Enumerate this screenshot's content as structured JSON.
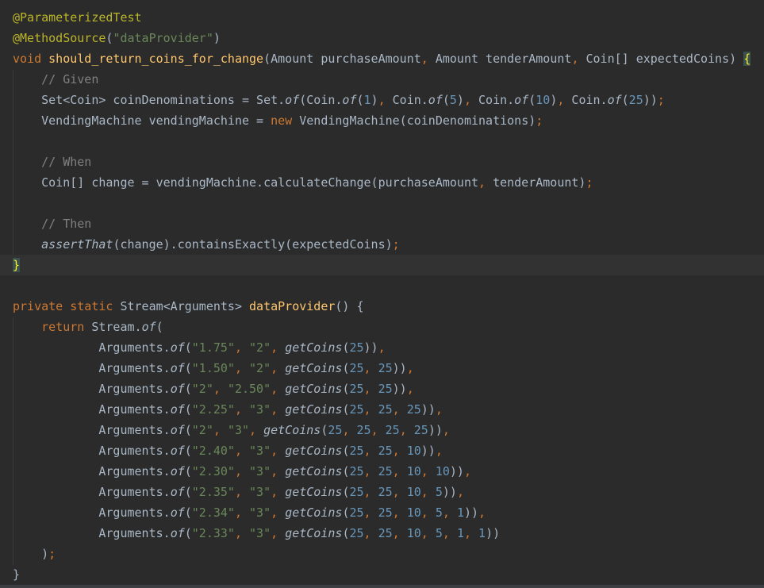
{
  "editor": {
    "colors": {
      "background": "#2b2b2b",
      "text": "#a9b7c6",
      "annotation": "#bbb529",
      "keyword": "#cc7832",
      "string": "#6a8759",
      "number": "#6897bb",
      "method_decl": "#ffc66d",
      "comment": "#808080"
    },
    "lines": [
      {
        "segs": [
          {
            "t": "@ParameterizedTest",
            "c": "ann"
          }
        ]
      },
      {
        "segs": [
          {
            "t": "@MethodSource",
            "c": "ann"
          },
          {
            "t": "("
          },
          {
            "t": "\"dataProvider\"",
            "c": "str"
          },
          {
            "t": ")"
          }
        ]
      },
      {
        "segs": [
          {
            "t": "void ",
            "c": "kw"
          },
          {
            "t": "should_return_coins_for_change",
            "c": "fn"
          },
          {
            "t": "(Amount purchaseAmount"
          },
          {
            "t": ", ",
            "c": "kw"
          },
          {
            "t": "Amount tenderAmount"
          },
          {
            "t": ", ",
            "c": "kw"
          },
          {
            "t": "Coin[] expectedCoins) "
          },
          {
            "t": "{",
            "c": "brace-match"
          }
        ]
      },
      {
        "segs": [
          {
            "t": "    "
          },
          {
            "t": "// Given",
            "c": "cm"
          }
        ]
      },
      {
        "segs": [
          {
            "t": "    Set<Coin> coinDenominations = Set."
          },
          {
            "t": "of",
            "c": "it"
          },
          {
            "t": "(Coin."
          },
          {
            "t": "of",
            "c": "it"
          },
          {
            "t": "("
          },
          {
            "t": "1",
            "c": "num"
          },
          {
            "t": ")"
          },
          {
            "t": ", ",
            "c": "kw"
          },
          {
            "t": "Coin."
          },
          {
            "t": "of",
            "c": "it"
          },
          {
            "t": "("
          },
          {
            "t": "5",
            "c": "num"
          },
          {
            "t": ")"
          },
          {
            "t": ", ",
            "c": "kw"
          },
          {
            "t": "Coin."
          },
          {
            "t": "of",
            "c": "it"
          },
          {
            "t": "("
          },
          {
            "t": "10",
            "c": "num"
          },
          {
            "t": ")"
          },
          {
            "t": ", ",
            "c": "kw"
          },
          {
            "t": "Coin."
          },
          {
            "t": "of",
            "c": "it"
          },
          {
            "t": "("
          },
          {
            "t": "25",
            "c": "num"
          },
          {
            "t": "))"
          },
          {
            "t": ";",
            "c": "kw"
          }
        ]
      },
      {
        "segs": [
          {
            "t": "    VendingMachine vendingMachine = "
          },
          {
            "t": "new ",
            "c": "kw"
          },
          {
            "t": "VendingMachine(coinDenominations)"
          },
          {
            "t": ";",
            "c": "kw"
          }
        ]
      },
      {
        "segs": [
          {
            "t": ""
          }
        ]
      },
      {
        "segs": [
          {
            "t": "    "
          },
          {
            "t": "// When",
            "c": "cm"
          }
        ]
      },
      {
        "segs": [
          {
            "t": "    Coin[] change = vendingMachine.calculateChange(purchaseAmount"
          },
          {
            "t": ", ",
            "c": "kw"
          },
          {
            "t": "tenderAmount)"
          },
          {
            "t": ";",
            "c": "kw"
          }
        ]
      },
      {
        "segs": [
          {
            "t": ""
          }
        ]
      },
      {
        "segs": [
          {
            "t": "    "
          },
          {
            "t": "// Then",
            "c": "cm"
          }
        ]
      },
      {
        "segs": [
          {
            "t": "    "
          },
          {
            "t": "assertThat",
            "c": "it"
          },
          {
            "t": "(change).containsExactly(expectedCoins)"
          },
          {
            "t": ";",
            "c": "kw"
          }
        ]
      },
      {
        "segs": [
          {
            "t": "}",
            "c": "brace-match"
          }
        ]
      },
      {
        "segs": [
          {
            "t": ""
          }
        ]
      },
      {
        "segs": [
          {
            "t": "private static ",
            "c": "kw"
          },
          {
            "t": "Stream<Arguments> "
          },
          {
            "t": "dataProvider",
            "c": "fn"
          },
          {
            "t": "() {"
          }
        ]
      },
      {
        "segs": [
          {
            "t": "    "
          },
          {
            "t": "return ",
            "c": "kw"
          },
          {
            "t": "Stream."
          },
          {
            "t": "of",
            "c": "it"
          },
          {
            "t": "("
          }
        ]
      },
      {
        "segs": [
          {
            "t": "            Arguments."
          },
          {
            "t": "of",
            "c": "it"
          },
          {
            "t": "("
          },
          {
            "t": "\"1.75\"",
            "c": "str"
          },
          {
            "t": ", ",
            "c": "kw"
          },
          {
            "t": "\"2\"",
            "c": "str"
          },
          {
            "t": ", ",
            "c": "kw"
          },
          {
            "t": "getCoins",
            "c": "it"
          },
          {
            "t": "("
          },
          {
            "t": "25",
            "c": "num"
          },
          {
            "t": "))"
          },
          {
            "t": ",",
            "c": "kw"
          }
        ]
      },
      {
        "segs": [
          {
            "t": "            Arguments."
          },
          {
            "t": "of",
            "c": "it"
          },
          {
            "t": "("
          },
          {
            "t": "\"1.50\"",
            "c": "str"
          },
          {
            "t": ", ",
            "c": "kw"
          },
          {
            "t": "\"2\"",
            "c": "str"
          },
          {
            "t": ", ",
            "c": "kw"
          },
          {
            "t": "getCoins",
            "c": "it"
          },
          {
            "t": "("
          },
          {
            "t": "25",
            "c": "num"
          },
          {
            "t": ", ",
            "c": "kw"
          },
          {
            "t": "25",
            "c": "num"
          },
          {
            "t": "))"
          },
          {
            "t": ",",
            "c": "kw"
          }
        ]
      },
      {
        "segs": [
          {
            "t": "            Arguments."
          },
          {
            "t": "of",
            "c": "it"
          },
          {
            "t": "("
          },
          {
            "t": "\"2\"",
            "c": "str"
          },
          {
            "t": ", ",
            "c": "kw"
          },
          {
            "t": "\"2.50\"",
            "c": "str"
          },
          {
            "t": ", ",
            "c": "kw"
          },
          {
            "t": "getCoins",
            "c": "it"
          },
          {
            "t": "("
          },
          {
            "t": "25",
            "c": "num"
          },
          {
            "t": ", ",
            "c": "kw"
          },
          {
            "t": "25",
            "c": "num"
          },
          {
            "t": "))"
          },
          {
            "t": ",",
            "c": "kw"
          }
        ]
      },
      {
        "segs": [
          {
            "t": "            Arguments."
          },
          {
            "t": "of",
            "c": "it"
          },
          {
            "t": "("
          },
          {
            "t": "\"2.25\"",
            "c": "str"
          },
          {
            "t": ", ",
            "c": "kw"
          },
          {
            "t": "\"3\"",
            "c": "str"
          },
          {
            "t": ", ",
            "c": "kw"
          },
          {
            "t": "getCoins",
            "c": "it"
          },
          {
            "t": "("
          },
          {
            "t": "25",
            "c": "num"
          },
          {
            "t": ", ",
            "c": "kw"
          },
          {
            "t": "25",
            "c": "num"
          },
          {
            "t": ", ",
            "c": "kw"
          },
          {
            "t": "25",
            "c": "num"
          },
          {
            "t": "))"
          },
          {
            "t": ",",
            "c": "kw"
          }
        ]
      },
      {
        "segs": [
          {
            "t": "            Arguments."
          },
          {
            "t": "of",
            "c": "it"
          },
          {
            "t": "("
          },
          {
            "t": "\"2\"",
            "c": "str"
          },
          {
            "t": ", ",
            "c": "kw"
          },
          {
            "t": "\"3\"",
            "c": "str"
          },
          {
            "t": ", ",
            "c": "kw"
          },
          {
            "t": "getCoins",
            "c": "it"
          },
          {
            "t": "("
          },
          {
            "t": "25",
            "c": "num"
          },
          {
            "t": ", ",
            "c": "kw"
          },
          {
            "t": "25",
            "c": "num"
          },
          {
            "t": ", ",
            "c": "kw"
          },
          {
            "t": "25",
            "c": "num"
          },
          {
            "t": ", ",
            "c": "kw"
          },
          {
            "t": "25",
            "c": "num"
          },
          {
            "t": "))"
          },
          {
            "t": ",",
            "c": "kw"
          }
        ]
      },
      {
        "segs": [
          {
            "t": "            Arguments."
          },
          {
            "t": "of",
            "c": "it"
          },
          {
            "t": "("
          },
          {
            "t": "\"2.40\"",
            "c": "str"
          },
          {
            "t": ", ",
            "c": "kw"
          },
          {
            "t": "\"3\"",
            "c": "str"
          },
          {
            "t": ", ",
            "c": "kw"
          },
          {
            "t": "getCoins",
            "c": "it"
          },
          {
            "t": "("
          },
          {
            "t": "25",
            "c": "num"
          },
          {
            "t": ", ",
            "c": "kw"
          },
          {
            "t": "25",
            "c": "num"
          },
          {
            "t": ", ",
            "c": "kw"
          },
          {
            "t": "10",
            "c": "num"
          },
          {
            "t": "))"
          },
          {
            "t": ",",
            "c": "kw"
          }
        ]
      },
      {
        "segs": [
          {
            "t": "            Arguments."
          },
          {
            "t": "of",
            "c": "it"
          },
          {
            "t": "("
          },
          {
            "t": "\"2.30\"",
            "c": "str"
          },
          {
            "t": ", ",
            "c": "kw"
          },
          {
            "t": "\"3\"",
            "c": "str"
          },
          {
            "t": ", ",
            "c": "kw"
          },
          {
            "t": "getCoins",
            "c": "it"
          },
          {
            "t": "("
          },
          {
            "t": "25",
            "c": "num"
          },
          {
            "t": ", ",
            "c": "kw"
          },
          {
            "t": "25",
            "c": "num"
          },
          {
            "t": ", ",
            "c": "kw"
          },
          {
            "t": "10",
            "c": "num"
          },
          {
            "t": ", ",
            "c": "kw"
          },
          {
            "t": "10",
            "c": "num"
          },
          {
            "t": "))"
          },
          {
            "t": ",",
            "c": "kw"
          }
        ]
      },
      {
        "segs": [
          {
            "t": "            Arguments."
          },
          {
            "t": "of",
            "c": "it"
          },
          {
            "t": "("
          },
          {
            "t": "\"2.35\"",
            "c": "str"
          },
          {
            "t": ", ",
            "c": "kw"
          },
          {
            "t": "\"3\"",
            "c": "str"
          },
          {
            "t": ", ",
            "c": "kw"
          },
          {
            "t": "getCoins",
            "c": "it"
          },
          {
            "t": "("
          },
          {
            "t": "25",
            "c": "num"
          },
          {
            "t": ", ",
            "c": "kw"
          },
          {
            "t": "25",
            "c": "num"
          },
          {
            "t": ", ",
            "c": "kw"
          },
          {
            "t": "10",
            "c": "num"
          },
          {
            "t": ", ",
            "c": "kw"
          },
          {
            "t": "5",
            "c": "num"
          },
          {
            "t": "))"
          },
          {
            "t": ",",
            "c": "kw"
          }
        ]
      },
      {
        "segs": [
          {
            "t": "            Arguments."
          },
          {
            "t": "of",
            "c": "it"
          },
          {
            "t": "("
          },
          {
            "t": "\"2.34\"",
            "c": "str"
          },
          {
            "t": ", ",
            "c": "kw"
          },
          {
            "t": "\"3\"",
            "c": "str"
          },
          {
            "t": ", ",
            "c": "kw"
          },
          {
            "t": "getCoins",
            "c": "it"
          },
          {
            "t": "("
          },
          {
            "t": "25",
            "c": "num"
          },
          {
            "t": ", ",
            "c": "kw"
          },
          {
            "t": "25",
            "c": "num"
          },
          {
            "t": ", ",
            "c": "kw"
          },
          {
            "t": "10",
            "c": "num"
          },
          {
            "t": ", ",
            "c": "kw"
          },
          {
            "t": "5",
            "c": "num"
          },
          {
            "t": ", ",
            "c": "kw"
          },
          {
            "t": "1",
            "c": "num"
          },
          {
            "t": "))"
          },
          {
            "t": ",",
            "c": "kw"
          }
        ]
      },
      {
        "segs": [
          {
            "t": "            Arguments."
          },
          {
            "t": "of",
            "c": "it"
          },
          {
            "t": "("
          },
          {
            "t": "\"2.33\"",
            "c": "str"
          },
          {
            "t": ", ",
            "c": "kw"
          },
          {
            "t": "\"3\"",
            "c": "str"
          },
          {
            "t": ", ",
            "c": "kw"
          },
          {
            "t": "getCoins",
            "c": "it"
          },
          {
            "t": "("
          },
          {
            "t": "25",
            "c": "num"
          },
          {
            "t": ", ",
            "c": "kw"
          },
          {
            "t": "25",
            "c": "num"
          },
          {
            "t": ", ",
            "c": "kw"
          },
          {
            "t": "10",
            "c": "num"
          },
          {
            "t": ", ",
            "c": "kw"
          },
          {
            "t": "5",
            "c": "num"
          },
          {
            "t": ", ",
            "c": "kw"
          },
          {
            "t": "1",
            "c": "num"
          },
          {
            "t": ", ",
            "c": "kw"
          },
          {
            "t": "1",
            "c": "num"
          },
          {
            "t": "))"
          }
        ]
      },
      {
        "segs": [
          {
            "t": "    )"
          },
          {
            "t": ";",
            "c": "kw"
          }
        ]
      },
      {
        "segs": [
          {
            "t": "}"
          }
        ]
      }
    ]
  }
}
